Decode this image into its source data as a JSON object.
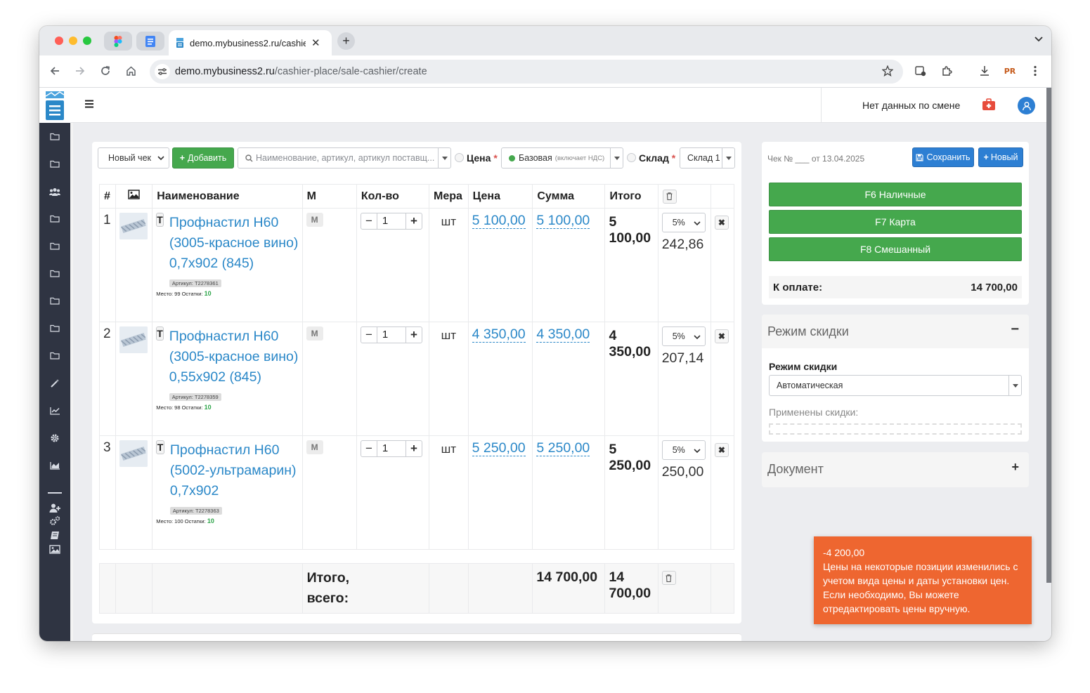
{
  "browser": {
    "tab_title": "demo.mybusiness2.ru/cashier-",
    "url_host": "demo.mybusiness2.ru",
    "url_path": "/cashier-place/sale-cashier/create"
  },
  "topbar": {
    "shift_status": "Нет данных по смене"
  },
  "toolbar": {
    "check_select": "Новый чек",
    "add_label": "Добавить",
    "search_placeholder": "Наименование, артикул, артикул поставщ...",
    "price_label": "Цена",
    "price_value": "Базовая",
    "price_note": "(включает НДС)",
    "warehouse_label": "Склад",
    "warehouse_value": "Склад 1",
    "required_mark": "*"
  },
  "table": {
    "headers": {
      "num": "#",
      "name": "Наименование",
      "m": "М",
      "qty": "Кол-во",
      "unit": "Мера",
      "price": "Цена",
      "sum": "Сумма",
      "total": "Итого"
    },
    "rows": [
      {
        "n": "1",
        "type": "Т",
        "name": "Профнастил Н60 (3005-красное вино) 0,7х902 (845)",
        "article": "Артикул: Т2278361",
        "location": "Место: 99 Остатки:",
        "stock": "10",
        "m": "М",
        "qty": "1",
        "unit": "шт",
        "price": "5 100,00",
        "sum": "5 100,00",
        "total": "5 100,00",
        "discount": "5%",
        "discount_amount": "242,86"
      },
      {
        "n": "2",
        "type": "Т",
        "name": "Профнастил Н60 (3005-красное вино) 0,55х902 (845)",
        "article": "Артикул: Т2278359",
        "location": "Место: 98 Остатки:",
        "stock": "10",
        "m": "М",
        "qty": "1",
        "unit": "шт",
        "price": "4 350,00",
        "sum": "4 350,00",
        "total": "4 350,00",
        "discount": "5%",
        "discount_amount": "207,14"
      },
      {
        "n": "3",
        "type": "Т",
        "name": "Профнастил Н60 (5002-ультрамарин) 0,7х902",
        "article": "Артикул: Т2278363",
        "location": "Место: 100 Остатки:",
        "stock": "10",
        "m": "М",
        "qty": "1",
        "unit": "шт",
        "price": "5 250,00",
        "sum": "5 250,00",
        "total": "5 250,00",
        "discount": "5%",
        "discount_amount": "250,00"
      }
    ],
    "footer": {
      "label": "Итого, всего:",
      "sum": "14 700,00",
      "total": "14 700,00"
    }
  },
  "right_panel": {
    "check_info": "Чек № ___ от 13.04.2025",
    "save_label": "Сохранить",
    "new_label": "Новый",
    "pay_cash": "F6 Наличные",
    "pay_card": "F7 Карта",
    "pay_mixed": "F8 Смешанный",
    "to_pay_label": "К оплате:",
    "to_pay_value": "14 700,00"
  },
  "discount_section": {
    "title": "Режим скидки",
    "toggle": "−",
    "field_label": "Режим скидки",
    "field_value": "Автоматическая",
    "applied_label": "Применены скидки:"
  },
  "document_section": {
    "title": "Документ",
    "toggle": "+"
  },
  "toast": {
    "amount": "-4 200,00",
    "message": "Цены на некоторые позиции изменились с учетом вида цены и даты установки цен. Если необходимо, Вы можете отредактировать цены вручную."
  },
  "colors": {
    "primary": "#2b88c8",
    "success": "#45a84d",
    "sidebar": "#2f3442",
    "toast": "#ee6630",
    "button_blue": "#2d7fd3"
  }
}
